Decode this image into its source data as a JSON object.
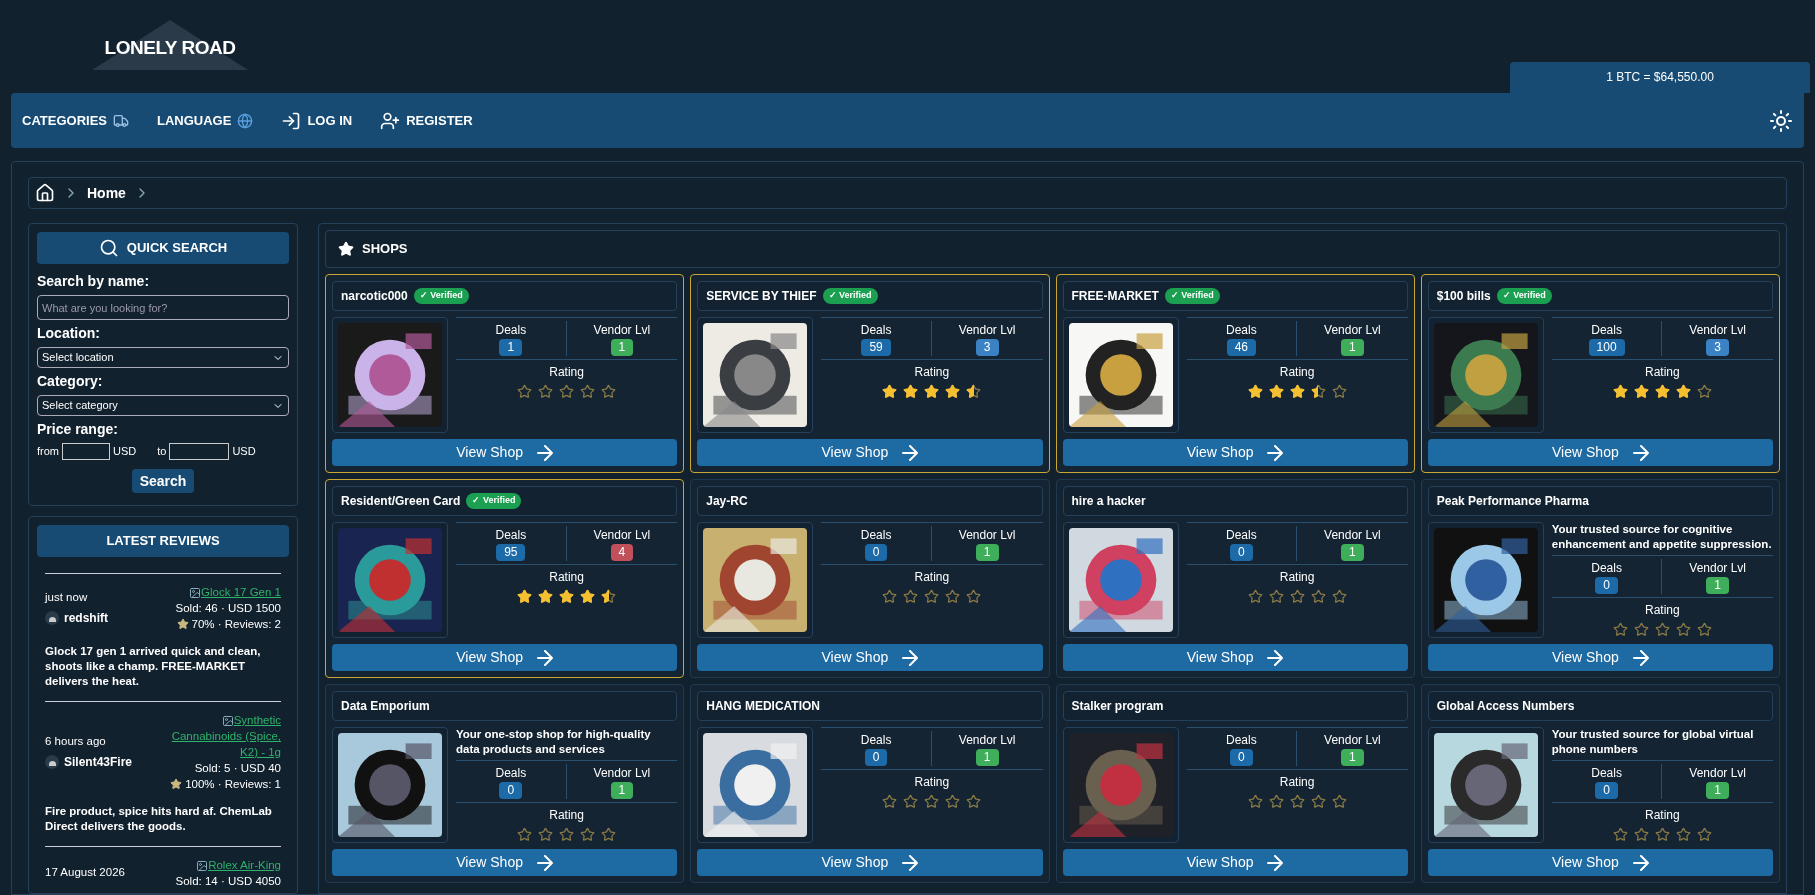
{
  "logo": {
    "text": "LONELY ROAD"
  },
  "btc_rate": "1 BTC = $64,550.00",
  "nav": [
    {
      "label": "CATEGORIES"
    },
    {
      "label": "LANGUAGE"
    },
    {
      "label": "LOG IN"
    },
    {
      "label": "REGISTER"
    }
  ],
  "breadcrumb": [
    "Home"
  ],
  "quick_search": {
    "title": "QUICK SEARCH",
    "name_label": "Search by name:",
    "name_placeholder": "What are you looking for?",
    "location_label": "Location:",
    "location_value": "Select location",
    "category_label": "Category:",
    "category_value": "Select category",
    "price_label": "Price range:",
    "from": "from",
    "to": "to",
    "currency_from": "USD",
    "currency_to": "USD",
    "button": "Search"
  },
  "latest_reviews": {
    "title": "LATEST REVIEWS",
    "reviews": [
      {
        "time": "just now",
        "user": "redshift",
        "product": "Glock 17 Gen 1",
        "sold": "Sold: 46 · USD 1500",
        "rating": "70% · Reviews: 2",
        "text": "Glock 17 gen 1 arrived quick and clean, shoots like a champ. FREE-MARKET delivers the heat."
      },
      {
        "time": "6 hours ago",
        "user": "Silent43Fire",
        "product": "Synthetic Cannabinoids (Spice, K2) - 1g",
        "sold": "Sold: 5 · USD 40",
        "rating": "100% · Reviews: 1",
        "text": "Fire product, spice hits hard af. ChemLab Direct delivers the goods."
      },
      {
        "time": "17 August 2026",
        "product": "Rolex Air-King",
        "sold": "Sold: 14 · USD 4050"
      }
    ]
  },
  "shops": {
    "title": "SHOPS",
    "items": [
      {
        "name": "narcotic000",
        "verified": true,
        "verified_label": "✓ Verified",
        "deals_label": "Deals",
        "deals": "1",
        "level_label": "Vendor Lvl",
        "level": "1",
        "color": "#3fae5a",
        "rating_label": "Rating",
        "stars": 0,
        "button": "View Shop"
      },
      {
        "name": "SERVICE BY THIEF",
        "verified": true,
        "verified_label": "✓ Verified",
        "deals_label": "Deals",
        "deals": "59",
        "level_label": "Vendor Lvl",
        "level": "3",
        "color": "#3b82c4",
        "rating_label": "Rating",
        "stars": 4.5,
        "button": "View Shop"
      },
      {
        "name": "FREE-MARKET",
        "verified": true,
        "verified_label": "✓ Verified",
        "deals_label": "Deals",
        "deals": "46",
        "level_label": "Vendor Lvl",
        "level": "1",
        "color": "#3fae5a",
        "rating_label": "Rating",
        "stars": 3.5,
        "button": "View Shop"
      },
      {
        "name": "$100 bills",
        "verified": true,
        "verified_label": "✓ Verified",
        "deals_label": "Deals",
        "deals": "100",
        "level_label": "Vendor Lvl",
        "level": "3",
        "color": "#3b82c4",
        "rating_label": "Rating",
        "stars": 4,
        "button": "View Shop"
      },
      {
        "name": "Resident/Green Card",
        "verified": true,
        "verified_label": "✓ Verified",
        "deals_label": "Deals",
        "deals": "95",
        "level_label": "Vendor Lvl",
        "level": "4",
        "color": "#c0505a",
        "rating_label": "Rating",
        "stars": 4.5,
        "button": "View Shop"
      },
      {
        "name": "Jay-RC",
        "verified": false,
        "deals_label": "Deals",
        "deals": "0",
        "level_label": "Vendor Lvl",
        "level": "1",
        "color": "#3fae5a",
        "rating_label": "Rating",
        "stars": 0,
        "button": "View Shop"
      },
      {
        "name": "hire a hacker",
        "verified": false,
        "deals_label": "Deals",
        "deals": "0",
        "level_label": "Vendor Lvl",
        "level": "1",
        "color": "#3fae5a",
        "rating_label": "Rating",
        "stars": 0,
        "button": "View Shop"
      },
      {
        "name": "Peak Performance Pharma",
        "verified": false,
        "description": "Your trusted source for cognitive enhancement and appetite suppression.",
        "deals_label": "Deals",
        "deals": "0",
        "level_label": "Vendor Lvl",
        "level": "1",
        "color": "#3fae5a",
        "rating_label": "Rating",
        "stars": 0,
        "button": "View Shop"
      },
      {
        "name": "Data Emporium",
        "verified": false,
        "description": "Your one-stop shop for high-quality data products and services",
        "deals_label": "Deals",
        "deals": "0",
        "level_label": "Vendor Lvl",
        "level": "1",
        "color": "#3fae5a",
        "rating_label": "Rating",
        "stars": 0,
        "button": "View Shop"
      },
      {
        "name": "HANG MEDICATION",
        "verified": false,
        "deals_label": "Deals",
        "deals": "0",
        "level_label": "Vendor Lvl",
        "level": "1",
        "color": "#3fae5a",
        "rating_label": "Rating",
        "stars": 0,
        "button": "View Shop"
      },
      {
        "name": "Stalker program",
        "verified": false,
        "deals_label": "Deals",
        "deals": "0",
        "level_label": "Vendor Lvl",
        "level": "1",
        "color": "#3fae5a",
        "rating_label": "Rating",
        "stars": 0,
        "button": "View Shop"
      },
      {
        "name": "Global Access Numbers",
        "verified": false,
        "description": "Your trusted source for global virtual phone numbers",
        "deals_label": "Deals",
        "deals": "0",
        "level_label": "Vendor Lvl",
        "level": "1",
        "color": "#3fae5a",
        "rating_label": "Rating",
        "stars": 0,
        "button": "View Shop"
      }
    ]
  }
}
